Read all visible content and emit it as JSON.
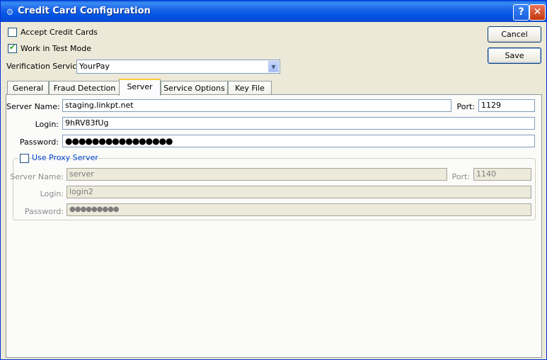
{
  "window": {
    "title": "Credit Card Configuration",
    "help_label": "?",
    "close_label": "✕"
  },
  "options": {
    "accept_credit_cards": {
      "label": "Accept Credit Cards",
      "checked": false
    },
    "work_in_test_mode": {
      "label": "Work in Test Mode",
      "checked": true
    }
  },
  "buttons": {
    "cancel": "Cancel",
    "save": "Save"
  },
  "verification": {
    "label": "Verification Service:",
    "value": "YourPay"
  },
  "tabs": [
    {
      "label": "General",
      "active": false
    },
    {
      "label": "Fraud Detection",
      "active": false
    },
    {
      "label": "Server",
      "active": true
    },
    {
      "label": "Service Options",
      "active": false
    },
    {
      "label": "Key File",
      "active": false
    }
  ],
  "server": {
    "server_name_label": "Server Name:",
    "server_name": "staging.linkpt.net",
    "port_label": "Port:",
    "port": "1129",
    "login_label": "Login:",
    "login": "9hRV83fUg",
    "password_label": "Password:",
    "password_mask": "●●●●●●●●●●●●●●●●"
  },
  "proxy": {
    "use_proxy_label": "Use Proxy Server",
    "enabled": false,
    "server_name_label": "Server Name:",
    "server_name": "server",
    "port_label": "Port:",
    "port": "1140",
    "login_label": "Login:",
    "login": "login2",
    "password_label": "Password:",
    "password_mask": "●●●●●●●●●"
  }
}
